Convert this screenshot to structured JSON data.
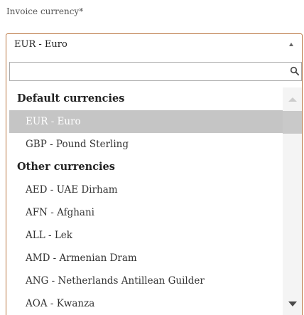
{
  "field": {
    "label": "Invoice currency*",
    "selected_value": "EUR - Euro"
  },
  "search": {
    "value": "",
    "placeholder": ""
  },
  "groups": [
    {
      "label": "Default currencies",
      "options": [
        {
          "label": "EUR - Euro",
          "selected": true
        },
        {
          "label": "GBP - Pound Sterling",
          "selected": false
        }
      ]
    },
    {
      "label": "Other currencies",
      "options": [
        {
          "label": "AED - UAE Dirham",
          "selected": false
        },
        {
          "label": "AFN - Afghani",
          "selected": false
        },
        {
          "label": "ALL - Lek",
          "selected": false
        },
        {
          "label": "AMD - Armenian Dram",
          "selected": false
        },
        {
          "label": "ANG - Netherlands Antillean Guilder",
          "selected": false
        },
        {
          "label": "AOA - Kwanza",
          "selected": false
        }
      ]
    }
  ],
  "colors": {
    "accent_border": "#b9743f",
    "selected_bg": "#c5c5c5",
    "scrollbar_track": "#f4f4f4",
    "scrollbar_thumb": "#c9c9c9"
  },
  "icons": {
    "search": "search-icon",
    "select_arrow": "chevron-up-icon",
    "scroll_up": "scroll-up-arrow-icon",
    "scroll_down": "scroll-down-arrow-icon"
  }
}
